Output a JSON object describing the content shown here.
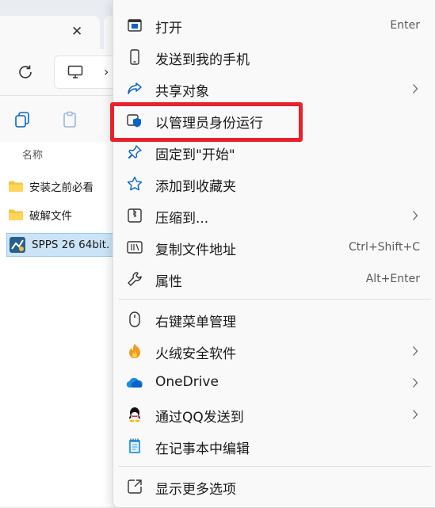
{
  "explorer": {
    "column_name": "名称",
    "files": [
      {
        "name": "安装之前必看",
        "type": "folder"
      },
      {
        "name": "破解文件",
        "type": "folder"
      },
      {
        "name": "SPPS 26 64bit.",
        "type": "installer"
      }
    ],
    "icons": [
      "close-icon",
      "refresh-icon",
      "monitor-icon",
      "chevron-right-icon",
      "copy-icon",
      "paste-icon"
    ]
  },
  "context_menu": {
    "items": [
      {
        "label": "打开",
        "shortcut": "Enter",
        "icon": "open-app-icon"
      },
      {
        "label": "发送到我的手机",
        "icon": "phone-icon"
      },
      {
        "label": "共享对象",
        "submenu": true,
        "icon": "share-icon"
      },
      {
        "label": "以管理员身份运行",
        "icon": "shield-icon",
        "highlighted": true
      },
      {
        "label": "固定到\"开始\"",
        "icon": "pin-icon"
      },
      {
        "label": "添加到收藏夹",
        "icon": "star-icon"
      },
      {
        "label": "压缩到...",
        "submenu": true,
        "icon": "zip-icon"
      },
      {
        "label": "复制文件地址",
        "shortcut": "Ctrl+Shift+C",
        "icon": "copy-path-icon"
      },
      {
        "label": "属性",
        "shortcut": "Alt+Enter",
        "icon": "wrench-icon"
      },
      {
        "label": "右键菜单管理",
        "icon": "mouse-icon"
      },
      {
        "label": "火绒安全软件",
        "submenu": true,
        "icon": "huorong-icon"
      },
      {
        "label": "OneDrive",
        "submenu": true,
        "icon": "onedrive-icon"
      },
      {
        "label": "通过QQ发送到",
        "submenu": true,
        "icon": "qq-icon"
      },
      {
        "label": "在记事本中编辑",
        "icon": "notepad-icon"
      },
      {
        "label": "显示更多选项",
        "icon": "more-options-icon"
      }
    ]
  },
  "colors": {
    "highlight_box": "#e8212d",
    "accent": "#0a64c8"
  }
}
